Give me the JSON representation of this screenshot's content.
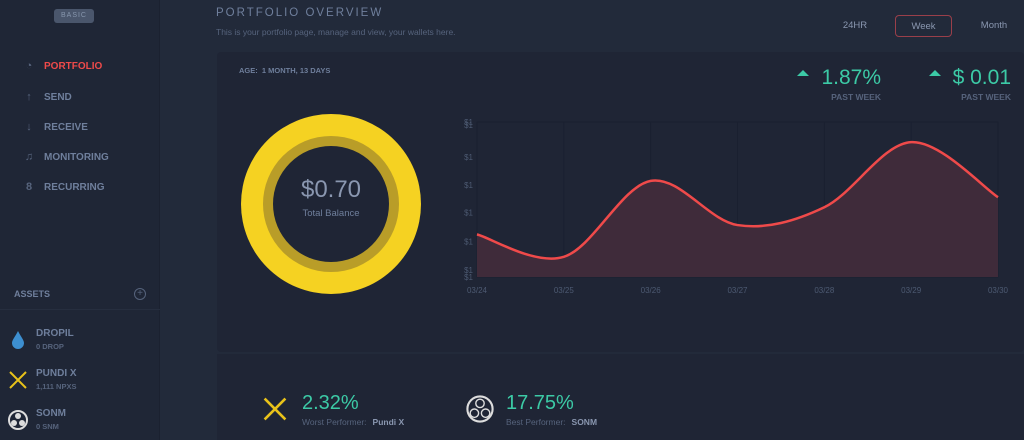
{
  "sidebar": {
    "plan_badge": "BASIC",
    "nav": [
      {
        "label": "PORTFOLIO",
        "icon": "pie-chart-icon"
      },
      {
        "label": "SEND",
        "icon": "arrow-up-icon"
      },
      {
        "label": "RECEIVE",
        "icon": "arrow-down-icon"
      },
      {
        "label": "MONITORING",
        "icon": "bell-icon"
      },
      {
        "label": "RECURRING",
        "icon": "recurring-icon"
      }
    ],
    "assets_heading": "ASSETS",
    "assets": [
      {
        "name": "DROPIL",
        "balance": "0 DROP"
      },
      {
        "name": "PUNDI X",
        "balance": "1,111 NPXS"
      },
      {
        "name": "SONM",
        "balance": "0 SNM"
      }
    ]
  },
  "header": {
    "title": "PORTFOLIO OVERVIEW",
    "subtitle": "This is your portfolio page, manage and view, your wallets here.",
    "tabs": [
      "24HR",
      "Week",
      "Month"
    ],
    "active_tab": "Week"
  },
  "card": {
    "age_label": "AGE:",
    "age_value": "1 MONTH,  13 DAYS",
    "stats": [
      {
        "value": "1.87%",
        "label": "PAST WEEK"
      },
      {
        "value": "$ 0.01",
        "label": "PAST WEEK"
      }
    ],
    "balance": "$0.70",
    "balance_label": "Total Balance"
  },
  "performers": {
    "worst": {
      "value": "2.32%",
      "label": "Worst Performer:",
      "asset": "Pundi X"
    },
    "best": {
      "value": "17.75%",
      "label": "Best Performer:",
      "asset": "SONM"
    }
  },
  "colors": {
    "accent_red": "#ef4a4a",
    "positive": "#3ccaa6",
    "donut": "#f5d222"
  },
  "chart_data": {
    "type": "area",
    "x": [
      "03/24",
      "03/25",
      "03/26",
      "03/27",
      "03/28",
      "03/29",
      "03/30"
    ],
    "values": [
      0.6955,
      0.6926,
      0.7024,
      0.6967,
      0.699,
      0.7074,
      0.7003
    ],
    "ylim": [
      0.69,
      0.71
    ],
    "yticks": [
      {
        "value": 0.69,
        "label": "$1"
      },
      {
        "value": 0.6909,
        "label": "$1"
      },
      {
        "value": 0.6946,
        "label": "$1"
      },
      {
        "value": 0.6983,
        "label": "$1"
      },
      {
        "value": 0.7019,
        "label": "$1"
      },
      {
        "value": 0.7055,
        "label": "$1"
      },
      {
        "value": 0.7096,
        "label": "$1"
      },
      {
        "value": 0.71,
        "label": "$1"
      }
    ],
    "grid": true,
    "line_color": "#ef4a4a"
  }
}
